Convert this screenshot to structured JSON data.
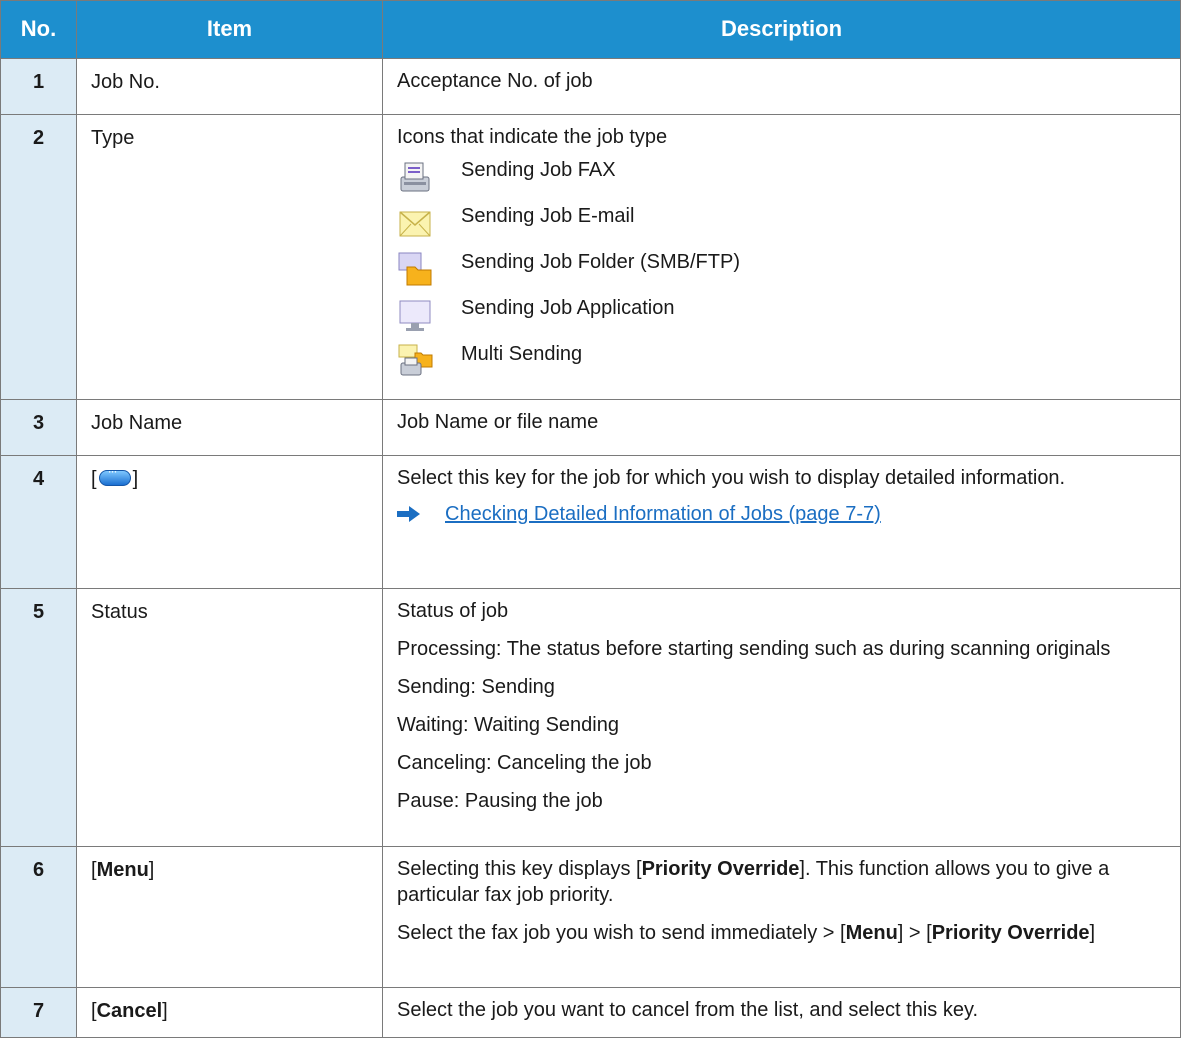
{
  "header": {
    "no": "No.",
    "item": "Item",
    "description": "Description"
  },
  "rows": [
    {
      "no": "1",
      "item": "Job No.",
      "desc": [
        "Acceptance No. of job"
      ]
    },
    {
      "no": "2",
      "item": "Type",
      "desc": [
        "Icons that indicate the job type"
      ],
      "icons": [
        {
          "icon": "fax-icon",
          "label": "Sending Job FAX"
        },
        {
          "icon": "email-icon",
          "label": "Sending Job E-mail"
        },
        {
          "icon": "folder-icon",
          "label": "Sending Job Folder (SMB/FTP)"
        },
        {
          "icon": "monitor-icon",
          "label": "Sending Job Application"
        },
        {
          "icon": "multi-send-icon",
          "label": "Multi Sending"
        }
      ]
    },
    {
      "no": "3",
      "item": "Job Name",
      "desc": [
        "Job Name or file name"
      ]
    },
    {
      "no": "4",
      "item_pre": "[",
      "item_post": "]",
      "item_icon": "detail-button-icon",
      "desc": [
        "Select this key for the job for which you wish to display detailed information."
      ],
      "link": "Checking Detailed Information of Jobs (page 7-7)"
    },
    {
      "no": "5",
      "item": "Status",
      "desc": [
        "Status of job",
        "Processing: The status before starting sending such as during scanning originals",
        "Sending: Sending",
        "Waiting: Waiting Sending",
        "Canceling: Canceling the job",
        "Pause: Pausing the job"
      ]
    },
    {
      "no": "6",
      "item_pre": "[",
      "item_bold": "Menu",
      "item_post": "]",
      "desc6a": {
        "pre": "Selecting this key displays [",
        "bold": "Priority Override",
        "post": "]. This function allows you to give a particular fax job priority."
      },
      "desc6b": {
        "pre": "Select the fax job you wish to send immediately > [",
        "bold1": "Menu",
        "mid": "] > [",
        "bold2": "Priority Override",
        "post": "]"
      }
    },
    {
      "no": "7",
      "item_pre": "[",
      "item_bold": "Cancel",
      "item_post": "]",
      "desc": [
        "Select the job you want to cancel from the list, and select this key."
      ]
    }
  ],
  "colors": {
    "header_bg": "#1d8fce",
    "no_col_bg": "#dcebf5",
    "link": "#1b6ec2"
  }
}
